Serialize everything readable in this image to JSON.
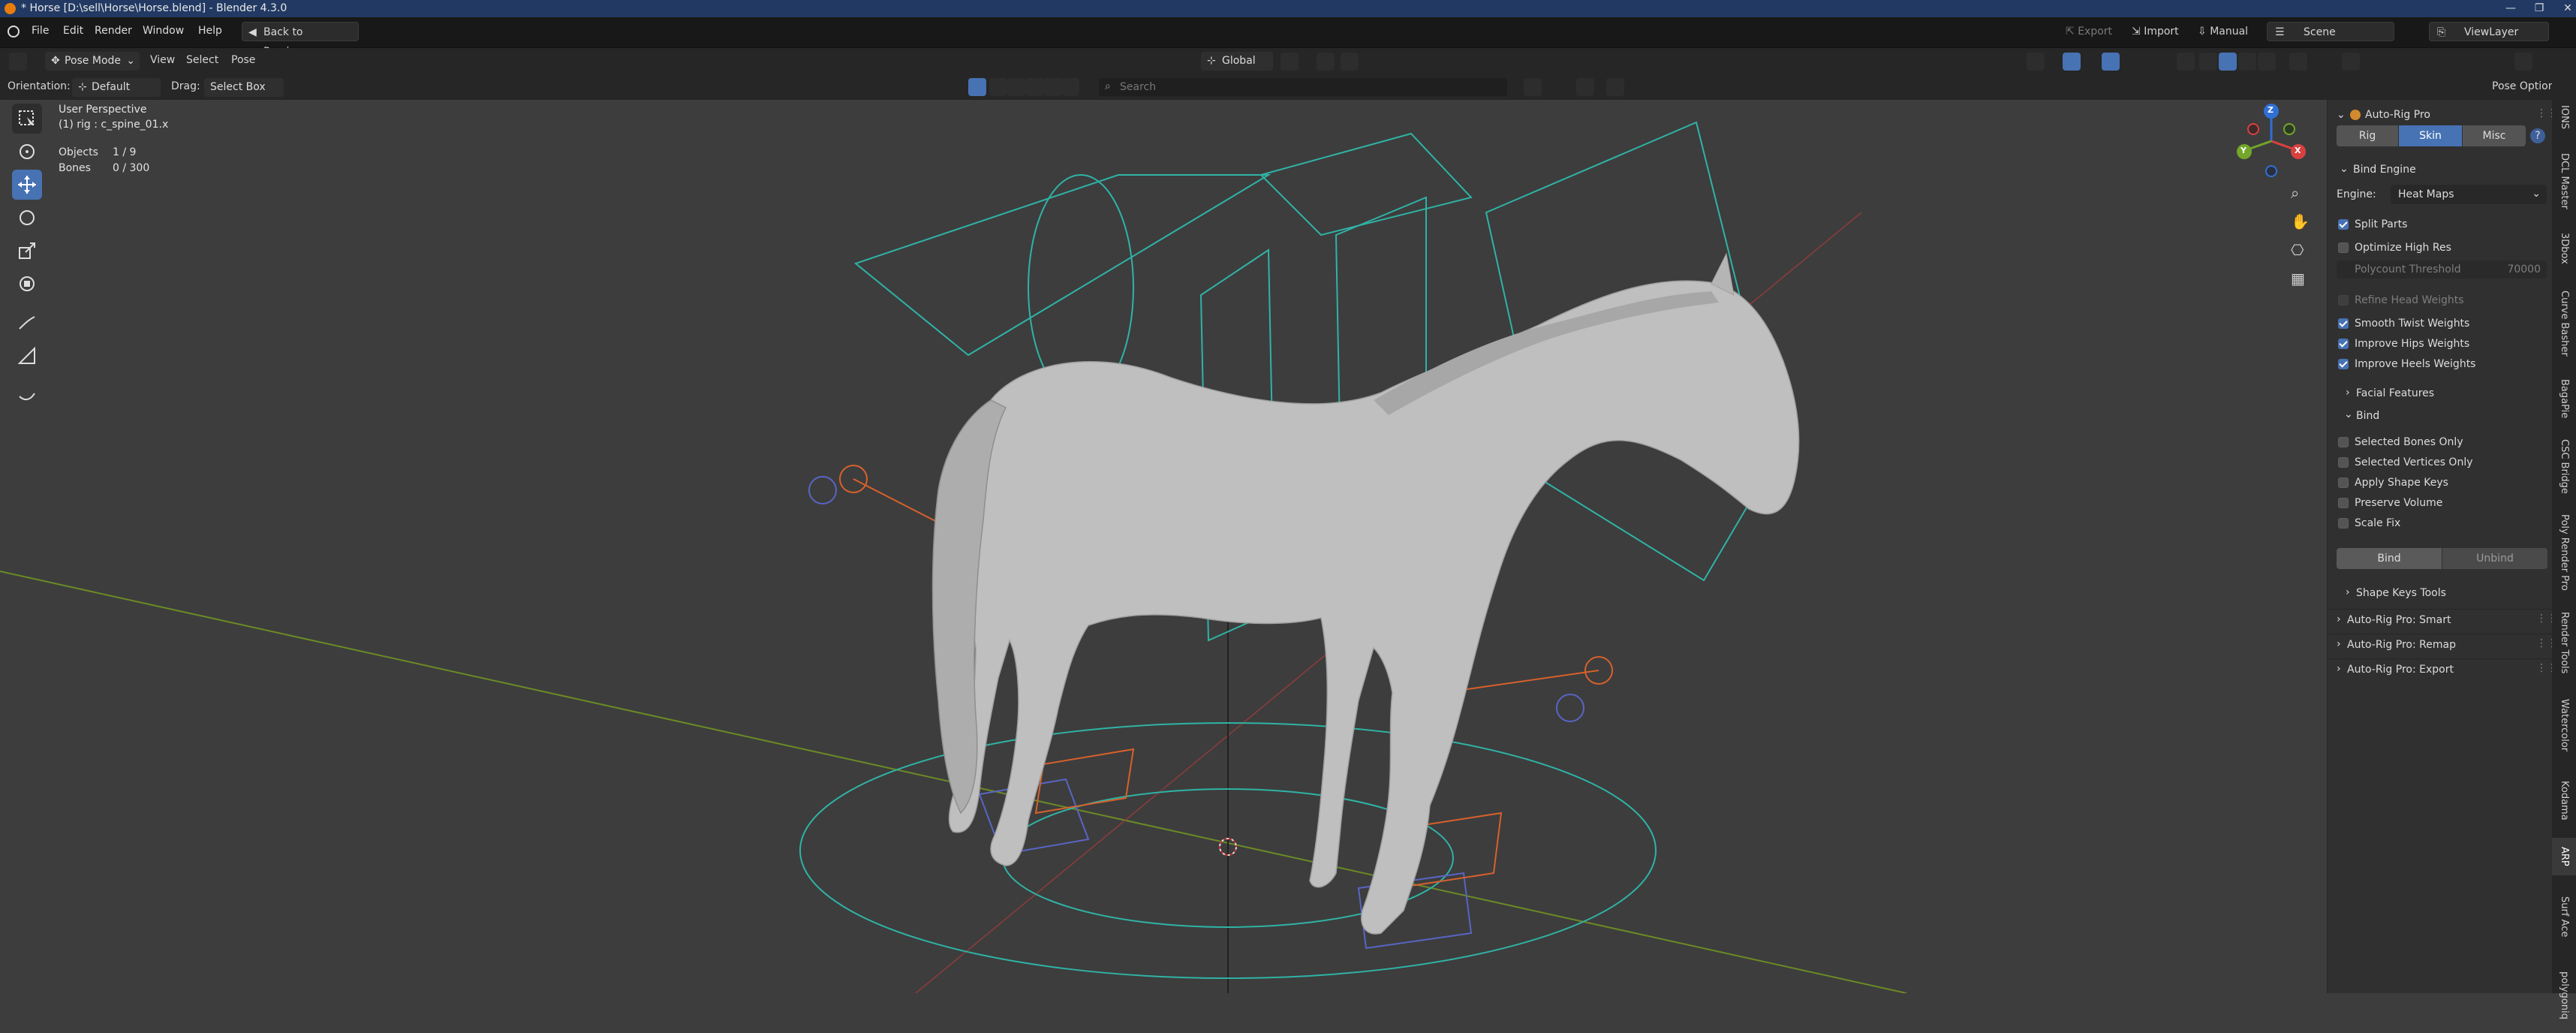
{
  "window": {
    "title": "* Horse [D:\\sell\\Horse\\Horse.blend] - Blender 4.3.0",
    "controls": [
      "—",
      "❐",
      "✕"
    ]
  },
  "menu": {
    "items": [
      "File",
      "Edit",
      "Render",
      "Window",
      "Help"
    ],
    "back_button": "Back to Previous",
    "export": "Export",
    "import": "Import",
    "manual": "Manual",
    "scene": "Scene",
    "view_layer": "ViewLayer"
  },
  "header": {
    "mode": "Pose Mode",
    "menus": [
      "View",
      "Select",
      "Pose"
    ],
    "transform_orientation": "Global",
    "search_placeholder": "Search",
    "pose_options": "Pose Options"
  },
  "tool_settings": {
    "orientation_label": "Orientation:",
    "orientation_value": "Default",
    "drag_label": "Drag:",
    "drag_value": "Select Box"
  },
  "viewport": {
    "view_name": "User Perspective",
    "active": "(1) rig : c_spine_01.x",
    "objects_label": "Objects",
    "objects_value": "1 / 9",
    "bones_label": "Bones",
    "bones_value": "0 / 300",
    "gizmo_axes": [
      "X",
      "Y",
      "Z"
    ],
    "colors": {
      "background": "#3d3d3d",
      "rig_teal": "#2fb3a6",
      "rig_blue": "#5865c4",
      "rig_orange": "#d6612c",
      "axis_red": "#a33b3b",
      "axis_green": "#6b8a26"
    }
  },
  "panel": {
    "title": "Auto-Rig Pro",
    "tabs": [
      "Rig",
      "Skin",
      "Misc"
    ],
    "active_tab": "Skin",
    "help": "?",
    "bind_engine_header": "Bind Engine",
    "engine_label": "Engine:",
    "engine_value": "Heat Maps",
    "split_parts": "Split Parts",
    "optimize_high_res": "Optimize High Res",
    "polycount_label": "Polycount Threshold",
    "polycount_value": "70000",
    "refine_head": "Refine Head Weights",
    "smooth_twist": "Smooth Twist Weights",
    "improve_hips": "Improve Hips Weights",
    "improve_heels": "Improve Heels Weights",
    "facial_features": "Facial Features",
    "bind_header": "Bind",
    "selected_bones": "Selected Bones Only",
    "selected_vertices": "Selected Vertices Only",
    "apply_shape_keys": "Apply Shape Keys",
    "preserve_volume": "Preserve Volume",
    "scale_fix": "Scale Fix",
    "bind_button": "Bind",
    "unbind_button": "Unbind",
    "shape_keys_tools": "Shape Keys Tools",
    "smart": "Auto-Rig Pro: Smart",
    "remap": "Auto-Rig Pro: Remap",
    "export": "Auto-Rig Pro: Export",
    "checkbox_states": {
      "split_parts": true,
      "optimize_high_res": false,
      "refine_head": false,
      "smooth_twist": true,
      "improve_hips": true,
      "improve_heels": true,
      "selected_bones": false,
      "selected_vertices": false,
      "apply_shape_keys": false,
      "preserve_volume": false,
      "scale_fix": false
    }
  },
  "side_tabs": [
    "IONS",
    "DCL Master",
    "3Dbox",
    "Curve Basher",
    "BagaPie",
    "CSC Bridge",
    "Poly Render Pro",
    "Render Tools",
    "Watercolor",
    "Kodama",
    "ARP",
    "Surf Ace",
    "polygoniq"
  ]
}
